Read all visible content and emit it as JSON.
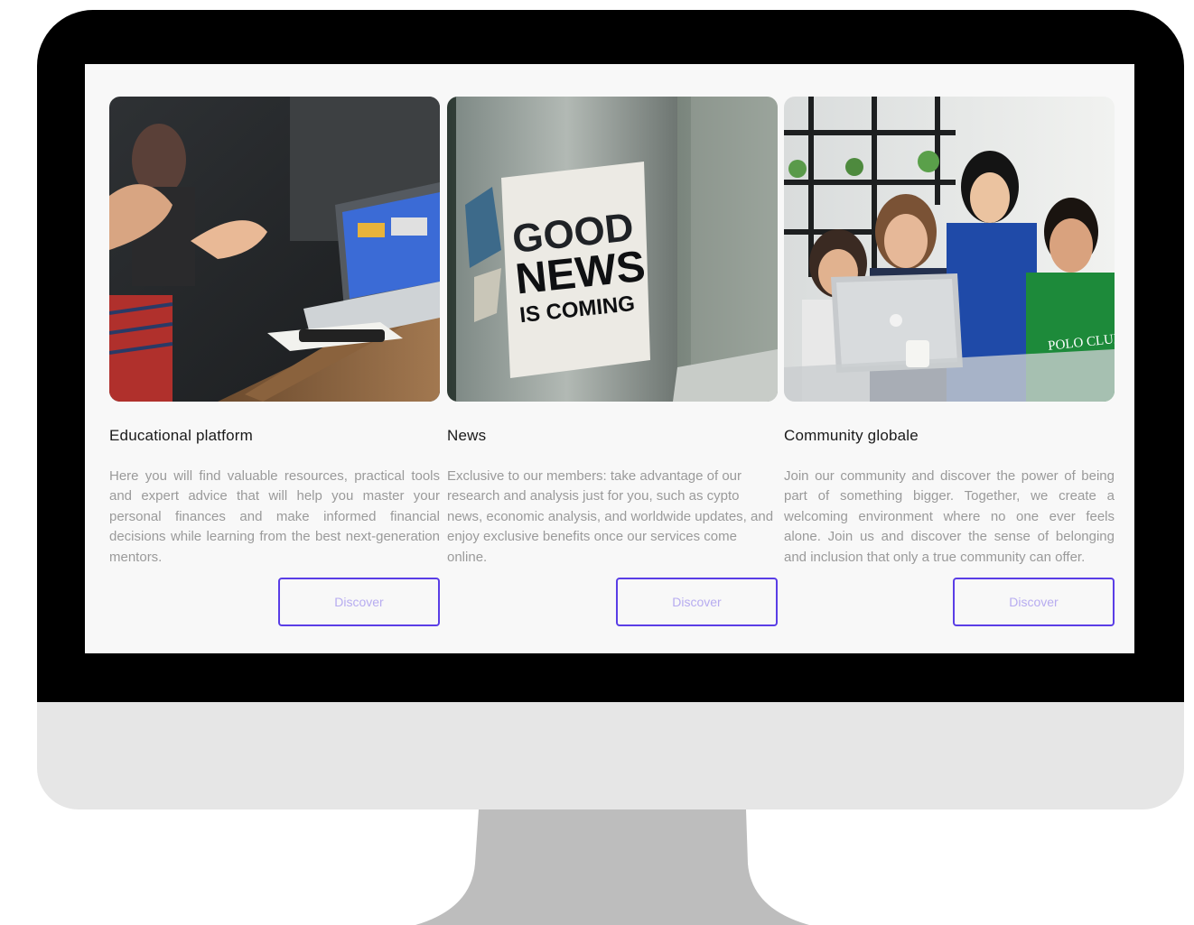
{
  "colors": {
    "screen_background": "#f8f8f8",
    "button_border": "#5a3ee6",
    "button_text": "#b7acf0",
    "title_text": "#1a1a1a",
    "description_text": "#9a9a9a"
  },
  "cards": [
    {
      "image": "meeting-laptop-photo",
      "title": "Educational platform",
      "description": "Here you will find valuable resources, practical tools and expert advice that will help you master your personal finances and make informed financial decisions while learning from the best next-generation mentors.",
      "button_label": "Discover"
    },
    {
      "image": "good-news-poster-photo",
      "poster_lines": [
        "GOOD",
        "NEWS",
        "IS COMING"
      ],
      "title": "News",
      "description": "Exclusive to our members: take advantage of our research and analysis just for you, such as cypto news, economic analysis, and worldwide updates, and enjoy exclusive benefits once our services come online.",
      "button_label": "Discover"
    },
    {
      "image": "team-laptop-photo",
      "shirt_text": "POLO CLUB",
      "title": "Community globale",
      "description": "Join our community and discover the power of being part of something bigger. Together, we create a welcoming environment where no one ever feels alone. Join us and discover the sense of belonging and inclusion that only a true community can offer.",
      "button_label": "Discover"
    }
  ]
}
